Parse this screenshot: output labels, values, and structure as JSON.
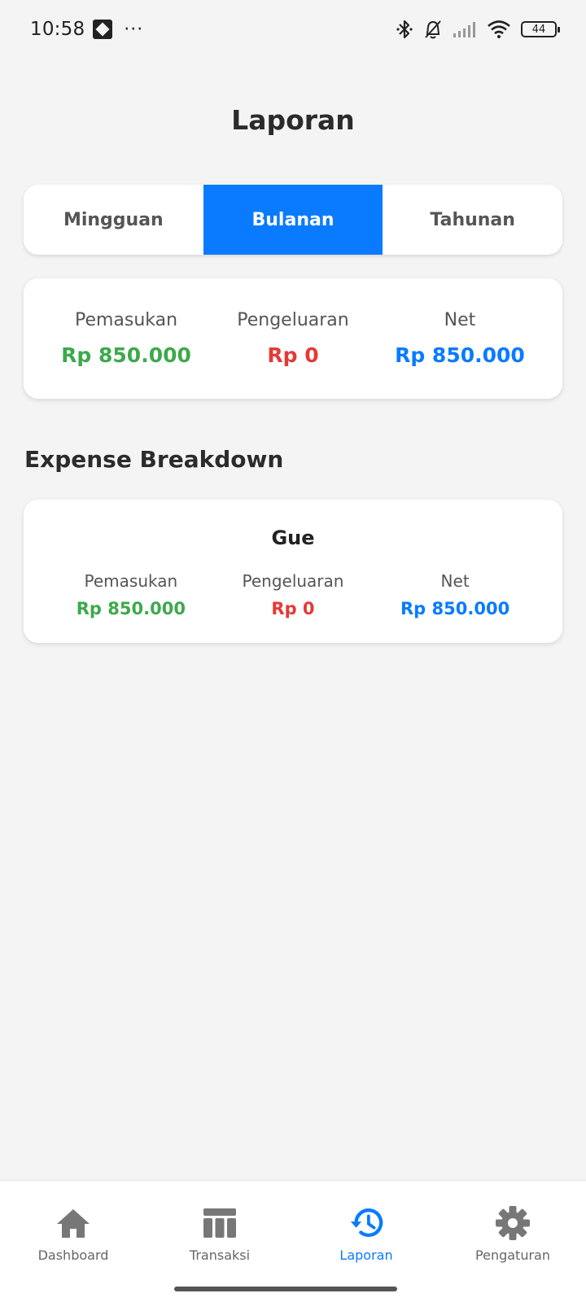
{
  "status_bar": {
    "time": "10:58",
    "battery": "44"
  },
  "title": "Laporan",
  "tabs": [
    {
      "label": "Mingguan",
      "active": false
    },
    {
      "label": "Bulanan",
      "active": true
    },
    {
      "label": "Tahunan",
      "active": false
    }
  ],
  "summary": {
    "income_label": "Pemasukan",
    "income_value": "Rp 850.000",
    "expense_label": "Pengeluaran",
    "expense_value": "Rp 0",
    "net_label": "Net",
    "net_value": "Rp 850.000"
  },
  "breakdown": {
    "title": "Expense Breakdown",
    "items": [
      {
        "name": "Gue",
        "income_label": "Pemasukan",
        "income_value": "Rp 850.000",
        "expense_label": "Pengeluaran",
        "expense_value": "Rp 0",
        "net_label": "Net",
        "net_value": "Rp 850.000"
      }
    ]
  },
  "nav": [
    {
      "label": "Dashboard",
      "icon": "home-icon",
      "active": false
    },
    {
      "label": "Transaksi",
      "icon": "table-icon",
      "active": false
    },
    {
      "label": "Laporan",
      "icon": "history-icon",
      "active": true
    },
    {
      "label": "Pengaturan",
      "icon": "gear-icon",
      "active": false
    }
  ],
  "colors": {
    "accent": "#0a7bff",
    "income": "#3da94b",
    "expense": "#e53935",
    "net": "#0a7bff",
    "background": "#f4f4f4"
  }
}
